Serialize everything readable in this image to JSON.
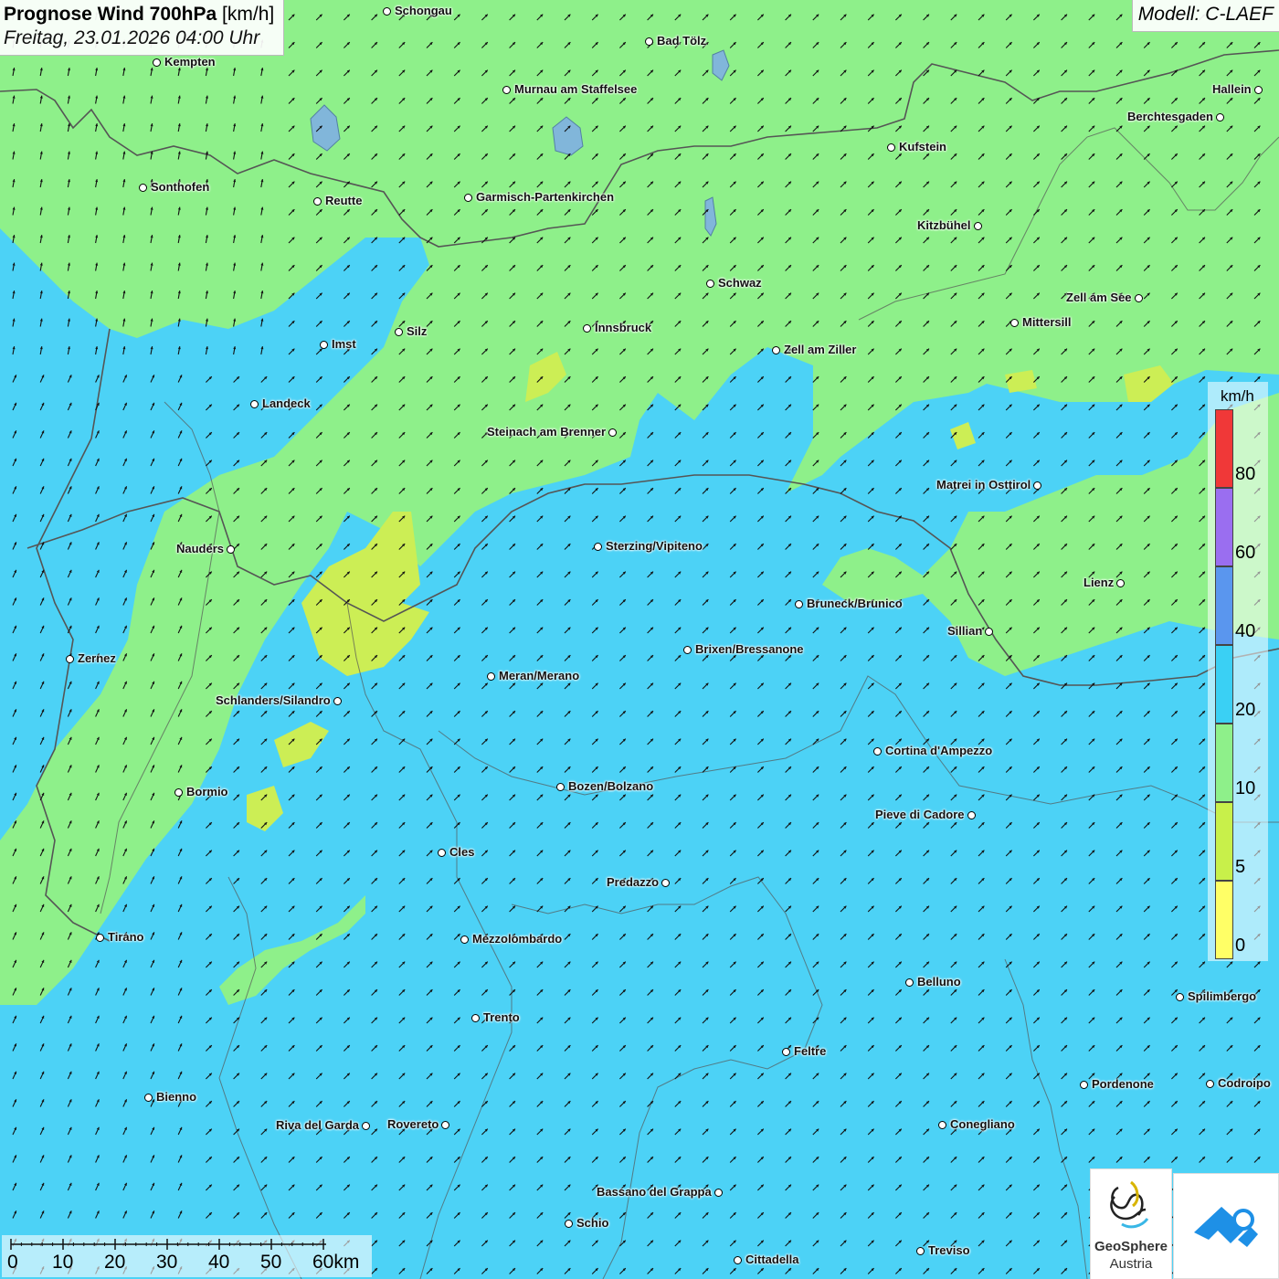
{
  "title": {
    "main_bold": "Prognose Wind 700hPa",
    "main_unit": "[km/h]",
    "datetime": "Freitag, 23.01.2026 04:00 Uhr"
  },
  "model": "Modell: C-LAEF",
  "legend": {
    "unit": "km/h",
    "bins": [
      {
        "label": "0",
        "color": "#ffff66"
      },
      {
        "label": "5",
        "color": "#c8f04a"
      },
      {
        "label": "10",
        "color": "#8ef08a"
      },
      {
        "label": "20",
        "color": "#3ad0f4"
      },
      {
        "label": "40",
        "color": "#5a96ee"
      },
      {
        "label": "60",
        "color": "#9a6ef0"
      },
      {
        "label": "80",
        "color": "#f03838"
      }
    ]
  },
  "scalebar": {
    "labels": [
      "0",
      "10",
      "20",
      "30",
      "40",
      "50",
      "60km"
    ]
  },
  "colors": {
    "green_field": "#8ef08a",
    "blue_field": "#4cd2f6",
    "yellow_field": "#ccee55",
    "border": "#555555",
    "lake": "#7fa8ee"
  },
  "cities": [
    {
      "name": "Schongau"
    },
    {
      "name": "Bad Tölz"
    },
    {
      "name": "Kempten"
    },
    {
      "name": "Murnau am Staffelsee"
    },
    {
      "name": "Hallein"
    },
    {
      "name": "Berchtesgaden"
    },
    {
      "name": "Kufstein"
    },
    {
      "name": "Sonthofen"
    },
    {
      "name": "Reutte"
    },
    {
      "name": "Garmisch-Partenkirchen"
    },
    {
      "name": "Kitzbühel"
    },
    {
      "name": "Schwaz"
    },
    {
      "name": "Zell am See"
    },
    {
      "name": "Mittersill"
    },
    {
      "name": "Imst"
    },
    {
      "name": "Silz"
    },
    {
      "name": "Innsbruck"
    },
    {
      "name": "Zell am Ziller"
    },
    {
      "name": "Landeck"
    },
    {
      "name": "Steinach am Brenner"
    },
    {
      "name": "Matrei in Osttirol"
    },
    {
      "name": "Nauders"
    },
    {
      "name": "Sterzing/Vipiteno"
    },
    {
      "name": "Lienz"
    },
    {
      "name": "Bruneck/Brunico"
    },
    {
      "name": "Sillian"
    },
    {
      "name": "Zernez"
    },
    {
      "name": "Brixen/Bressanone"
    },
    {
      "name": "Meran/Merano"
    },
    {
      "name": "Schlanders/Silandro"
    },
    {
      "name": "Cortina d'Ampezzo"
    },
    {
      "name": "Bormio"
    },
    {
      "name": "Bozen/Bolzano"
    },
    {
      "name": "Pieve di Cadore"
    },
    {
      "name": "Cles"
    },
    {
      "name": "Predazzo"
    },
    {
      "name": "Tirano"
    },
    {
      "name": "Mezzolombardo"
    },
    {
      "name": "Belluno"
    },
    {
      "name": "Spilimbergo"
    },
    {
      "name": "Trento"
    },
    {
      "name": "Feltre"
    },
    {
      "name": "Pordenone"
    },
    {
      "name": "Codroipo"
    },
    {
      "name": "Bienno"
    },
    {
      "name": "Riva del Garda"
    },
    {
      "name": "Rovereto"
    },
    {
      "name": "Conegliano"
    },
    {
      "name": "Bassano del Grappa"
    },
    {
      "name": "Schio"
    },
    {
      "name": "Treviso"
    },
    {
      "name": "Cittadella"
    }
  ],
  "logos": {
    "geosphere_name": "GeoSphere",
    "geosphere_sub": "Austria"
  }
}
